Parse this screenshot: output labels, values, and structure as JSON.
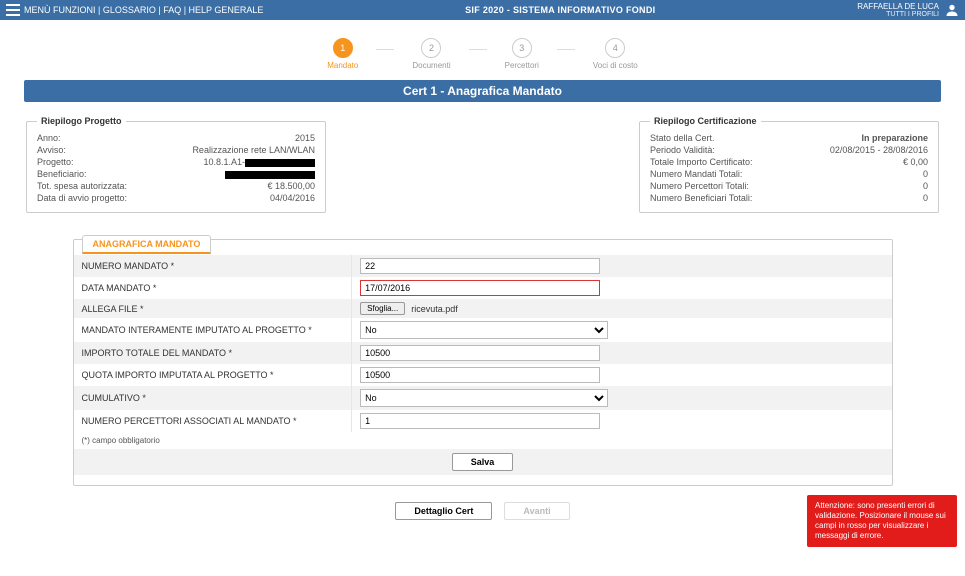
{
  "topbar": {
    "menu_links": "MENÙ FUNZIONI | GLOSSARIO | FAQ | HELP GENERALE",
    "title": "SIF 2020 - SISTEMA INFORMATIVO FONDI",
    "user_name": "RAFFAELLA DE LUCA",
    "user_sub": "TUTTI I PROFILI"
  },
  "wizard": {
    "steps": [
      {
        "num": "1",
        "label": "Mandato",
        "active": true
      },
      {
        "num": "2",
        "label": "Documenti",
        "active": false
      },
      {
        "num": "3",
        "label": "Percettori",
        "active": false
      },
      {
        "num": "4",
        "label": "Voci di costo",
        "active": false
      }
    ]
  },
  "title": "Cert 1 - Anagrafica Mandato",
  "left_box": {
    "legend": "Riepilogo Progetto",
    "rows": [
      {
        "k": "Anno:",
        "v": "2015"
      },
      {
        "k": "Avviso:",
        "v": "Realizzazione rete LAN/WLAN"
      },
      {
        "k": "Progetto:",
        "v": "10.8.1.A1-"
      },
      {
        "k": "Beneficiario:",
        "v": ""
      },
      {
        "k": "Tot. spesa autorizzata:",
        "v": "€ 18.500,00"
      },
      {
        "k": "Data di avvio progetto:",
        "v": "04/04/2016"
      }
    ]
  },
  "right_box": {
    "legend": "Riepilogo Certificazione",
    "rows": [
      {
        "k": "Stato della Cert.",
        "v": "In preparazione"
      },
      {
        "k": "Periodo Validità:",
        "v": "02/08/2015 - 28/08/2016"
      },
      {
        "k": "Totale Importo Certificato:",
        "v": "€ 0,00"
      },
      {
        "k": "Numero Mandati Totali:",
        "v": "0"
      },
      {
        "k": "Numero Percettori Totali:",
        "v": "0"
      },
      {
        "k": "Numero Beneficiari Totali:",
        "v": "0"
      }
    ]
  },
  "form": {
    "tab": "ANAGRAFICA MANDATO",
    "rows": {
      "numero_mandato_label": "NUMERO MANDATO *",
      "numero_mandato_value": "22",
      "data_mandato_label": "DATA MANDATO *",
      "data_mandato_value": "17/07/2016",
      "allega_file_label": "ALLEGA FILE *",
      "file_btn": "Sfoglia...",
      "file_name": "ricevuta.pdf",
      "interamente_label": "MANDATO INTERAMENTE IMPUTATO AL PROGETTO *",
      "interamente_value": "No",
      "importo_totale_label": "IMPORTO TOTALE DEL MANDATO *",
      "importo_totale_value": "10500",
      "quota_label": "QUOTA IMPORTO IMPUTATA AL PROGETTO *",
      "quota_value": "10500",
      "cumulativo_label": "CUMULATIVO *",
      "cumulativo_value": "No",
      "num_percettori_label": "NUMERO PERCETTORI ASSOCIATI AL MANDATO *",
      "num_percettori_value": "1"
    },
    "note": "(*) campo obbligatorio",
    "save": "Salva"
  },
  "bottom": {
    "dettaglio": "Dettaglio Cert",
    "avanti": "Avanti"
  },
  "toast": "Attenzione: sono presenti errori di validazione. Posizionare il mouse sui campi in rosso per visualizzare i messaggi di errore."
}
